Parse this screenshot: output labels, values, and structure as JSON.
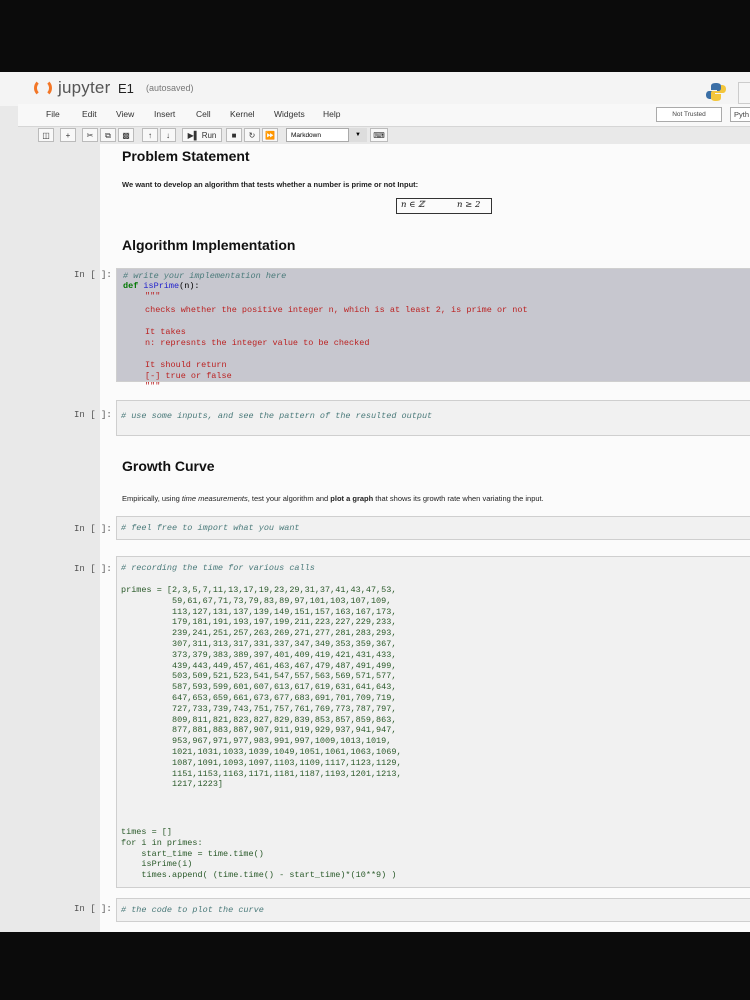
{
  "app": {
    "logo_text": "jupyter",
    "notebook_name": "E1",
    "autosave_status": "(autosaved)"
  },
  "menu": {
    "items": [
      "File",
      "Edit",
      "View",
      "Insert",
      "Cell",
      "Kernel",
      "Widgets",
      "Help"
    ],
    "trust_status": "Not Trusted",
    "kernel": "Pyth"
  },
  "toolbar": {
    "run_label": "Run",
    "cell_type": "Markdown"
  },
  "cells": {
    "problem_heading": "Problem Statement",
    "problem_text": "We want to develop an algorithm that tests whether a number is prime or not Input:",
    "math_n_in_z": "n ∈ ℤ",
    "math_n_geq_2": "n ≥ 2",
    "algo_heading": "Algorithm Implementation",
    "prompt_in": "In [ ]:",
    "impl_code": {
      "line1": "# write your implementation here",
      "line2_kw": "def ",
      "line2_fn": "isPrime",
      "line2_rest": "(n):",
      "doc_open": "\"\"\"",
      "doc1": "checks whether the positive integer n, which is at least 2, is prime or not",
      "doc2": "It takes",
      "doc3": "n: represnts the integer value to be checked",
      "doc4": "It should return",
      "doc5": "[-] true or false",
      "doc_close": "\"\"\""
    },
    "inputs_comment": "# use some inputs, and see the pattern of the resulted output",
    "growth_heading": "Growth Curve",
    "growth_text_1": "Empirically, using ",
    "growth_text_em": "time measurements",
    "growth_text_2": ", test your algorithm and ",
    "growth_text_bold": "plot a graph",
    "growth_text_3": " that shows its growth rate when variating the input.",
    "import_comment": "# feel free to import what you want",
    "timing_comment": "# recording the time for various calls",
    "primes_lines": [
      "primes = [2,3,5,7,11,13,17,19,23,29,31,37,41,43,47,53,",
      "          59,61,67,71,73,79,83,89,97,101,103,107,109,",
      "          113,127,131,137,139,149,151,157,163,167,173,",
      "          179,181,191,193,197,199,211,223,227,229,233,",
      "          239,241,251,257,263,269,271,277,281,283,293,",
      "          307,311,313,317,331,337,347,349,353,359,367,",
      "          373,379,383,389,397,401,409,419,421,431,433,",
      "          439,443,449,457,461,463,467,479,487,491,499,",
      "          503,509,521,523,541,547,557,563,569,571,577,",
      "          587,593,599,601,607,613,617,619,631,641,643,",
      "          647,653,659,661,673,677,683,691,701,709,719,",
      "          727,733,739,743,751,757,761,769,773,787,797,",
      "          809,811,821,823,827,829,839,853,857,859,863,",
      "          877,881,883,887,907,911,919,929,937,941,947,",
      "          953,967,971,977,983,991,997,1009,1013,1019,",
      "          1021,1031,1033,1039,1049,1051,1061,1063,1069,",
      "          1087,1091,1093,1097,1103,1109,1117,1123,1129,",
      "          1151,1153,1163,1171,1181,1187,1193,1201,1213,",
      "          1217,1223]"
    ],
    "times_lines": [
      "times = []",
      "for i in primes:",
      "    start_time = time.time()",
      "    isPrime(i)",
      "    times.append( (time.time() - start_time)*(10**9) )"
    ],
    "plot_comment": "# the code to plot the curve"
  }
}
